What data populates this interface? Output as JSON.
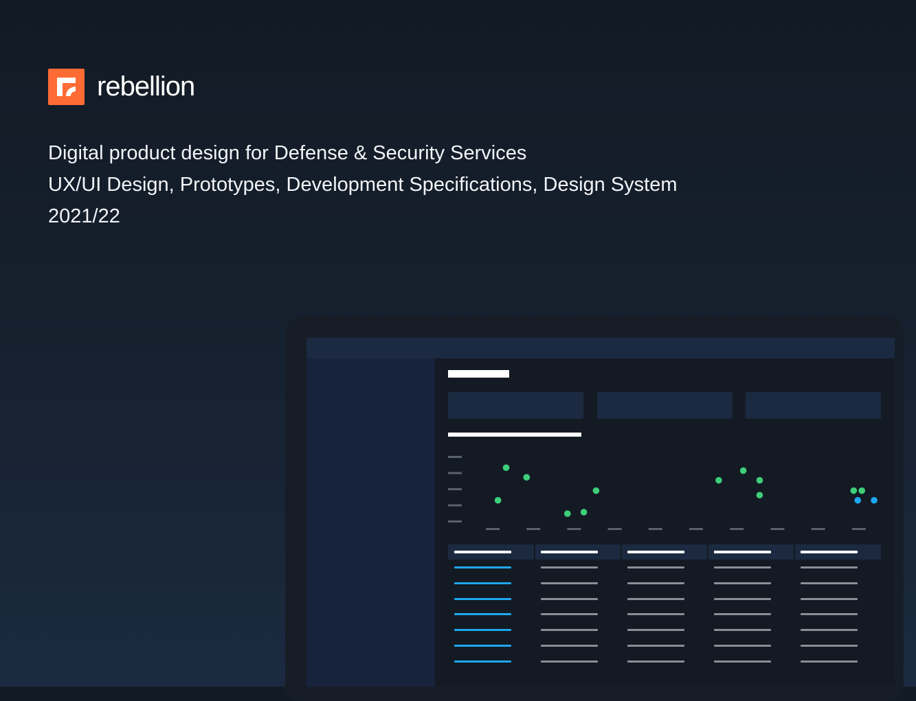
{
  "brand": {
    "name": "rebellion",
    "color": "#ff6b35"
  },
  "tagline": {
    "line1": "Digital product design for Defense & Security Services",
    "line2": "UX/UI Design, Prototypes, Development Specifications, Design System",
    "line3": "2021/22"
  },
  "mockup": {
    "accent_green": "#3ecf7a",
    "accent_blue": "#1ea7f0",
    "cards_count": 3,
    "chart_data": {
      "type": "scatter",
      "title": "",
      "xlabel": "",
      "ylabel": "",
      "xlim": [
        0,
        100
      ],
      "ylim": [
        0,
        100
      ],
      "series": [
        {
          "color": "#3ecf7a",
          "points": [
            [
              7,
              29
            ],
            [
              9,
              73
            ],
            [
              14,
              60
            ],
            [
              24,
              11
            ],
            [
              28,
              13
            ],
            [
              31,
              42
            ],
            [
              61,
              56
            ],
            [
              67,
              69
            ],
            [
              71,
              56
            ],
            [
              71,
              36
            ],
            [
              94,
              42
            ],
            [
              96,
              42
            ]
          ]
        },
        {
          "color": "#1ea7f0",
          "points": [
            [
              95,
              29
            ],
            [
              99,
              29
            ]
          ]
        }
      ]
    },
    "table": {
      "columns": 5,
      "rows": 7
    }
  }
}
